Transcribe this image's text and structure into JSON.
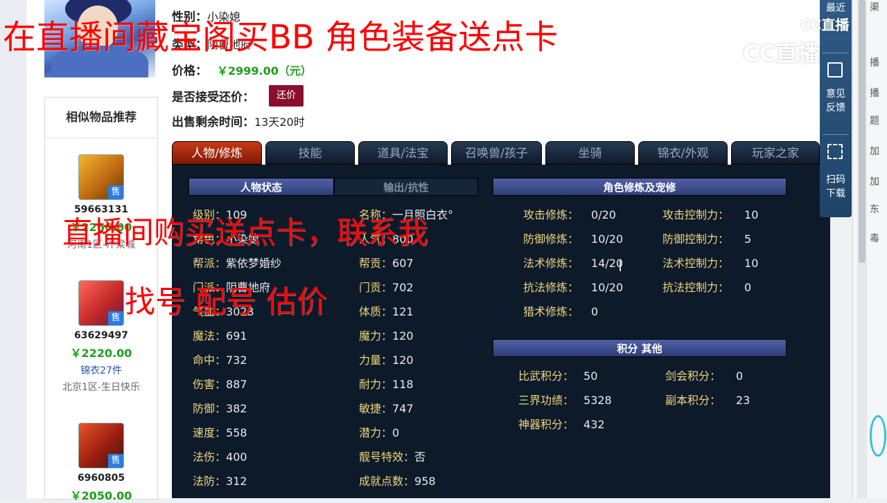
{
  "listing": {
    "gender_label": "性别：",
    "gender_value": "小染媳",
    "type_label": "类型：",
    "type_value": "阴曹地府",
    "price_label": "价格：",
    "price_value": "￥2999.00（元）",
    "haggle_label": "是否接受还价：",
    "haggle_button": "还价",
    "time_label": "出售剩余时间：",
    "time_value": "13天20时"
  },
  "similar": {
    "title": "相似物品推荐",
    "items": [
      {
        "id": "59663131",
        "price": "￥2266.00",
        "sub": "",
        "server": "河南1区-汴梁城"
      },
      {
        "id": "63629497",
        "price": "￥2220.00",
        "sub": "锦衣27件",
        "server": "北京1区-生日快乐"
      },
      {
        "id": "6960805",
        "price": "￥2050.00",
        "sub": "",
        "server": ""
      }
    ],
    "sell_badge": "售"
  },
  "tabs": [
    "人物/修炼",
    "技能",
    "道具/法宝",
    "召唤兽/孩子",
    "坐骑",
    "锦衣/外观",
    "玩家之家"
  ],
  "char_panel": {
    "tab_status": "人物状态",
    "tab_output": "输出/抗性",
    "col1": [
      {
        "label": "级别：",
        "value": "109"
      },
      {
        "label": "角色：",
        "value": "小染媳"
      },
      {
        "label": "帮派：",
        "value": "紫依梦婚纱"
      },
      {
        "label": "门派：",
        "value": "阴曹地府"
      },
      {
        "label": "气血：",
        "value": "3023"
      },
      {
        "label": "魔法：",
        "value": "691"
      },
      {
        "label": "命中：",
        "value": "732"
      },
      {
        "label": "伤害：",
        "value": "887"
      },
      {
        "label": "防御：",
        "value": "382"
      },
      {
        "label": "速度：",
        "value": "558"
      },
      {
        "label": "法伤：",
        "value": "400"
      },
      {
        "label": "法防：",
        "value": "312"
      }
    ],
    "col2": [
      {
        "label": "名称：",
        "value": "一月照白衣°"
      },
      {
        "label": "人气：",
        "value": "800"
      },
      {
        "label": "帮贡：",
        "value": "607"
      },
      {
        "label": "门贡：",
        "value": "702"
      },
      {
        "label": "体质：",
        "value": "121"
      },
      {
        "label": "魔力：",
        "value": "120"
      },
      {
        "label": "力量：",
        "value": "120"
      },
      {
        "label": "耐力：",
        "value": "118"
      },
      {
        "label": "敏捷：",
        "value": "747"
      },
      {
        "label": "潜力：",
        "value": "0"
      },
      {
        "label": "靓号特效：",
        "value": "否"
      },
      {
        "label": "成就点数：",
        "value": "958"
      }
    ]
  },
  "cultivation": {
    "title": "角色修炼及宠修",
    "left": [
      {
        "label": "攻击修炼：",
        "value": "0/20"
      },
      {
        "label": "防御修炼：",
        "value": "10/20"
      },
      {
        "label": "法术修炼：",
        "value": "14/20"
      },
      {
        "label": "抗法修炼：",
        "value": "10/20"
      },
      {
        "label": "猎术修炼：",
        "value": "0"
      }
    ],
    "right": [
      {
        "label": "攻击控制力：",
        "value": "10"
      },
      {
        "label": "防御控制力：",
        "value": "5"
      },
      {
        "label": "法术控制力：",
        "value": "10"
      },
      {
        "label": "抗法控制力：",
        "value": "0"
      }
    ]
  },
  "points": {
    "title": "积分 其他",
    "left": [
      {
        "label": "比武积分：",
        "value": "50"
      },
      {
        "label": "三界功绩：",
        "value": "5328"
      },
      {
        "label": "神器积分：",
        "value": "432"
      }
    ],
    "right": [
      {
        "label": "剑会积分：",
        "value": "0"
      },
      {
        "label": "副本积分：",
        "value": "23"
      }
    ]
  },
  "right_bar": {
    "recent": "最近",
    "feedback": [
      "意见",
      "反馈"
    ],
    "download": [
      "扫码",
      "下载"
    ]
  },
  "far_right_text": [
    "渠",
    "播",
    "播",
    "题",
    "加",
    "加",
    "东",
    "毒"
  ],
  "watermark": {
    "top": "CC直播",
    "main": "CC直播"
  },
  "overlays": {
    "title": "在直播间藏宝阁买BB 角色装备送点卡",
    "mid1": "直播间购买送点卡，联系我",
    "mid2": "找号 配号 估价"
  },
  "colors": {
    "tab_active": "#c63a16",
    "price_green": "#1aa11a",
    "overlay_red": "#ff0000",
    "haggle_btn": "#8a0f2e"
  }
}
